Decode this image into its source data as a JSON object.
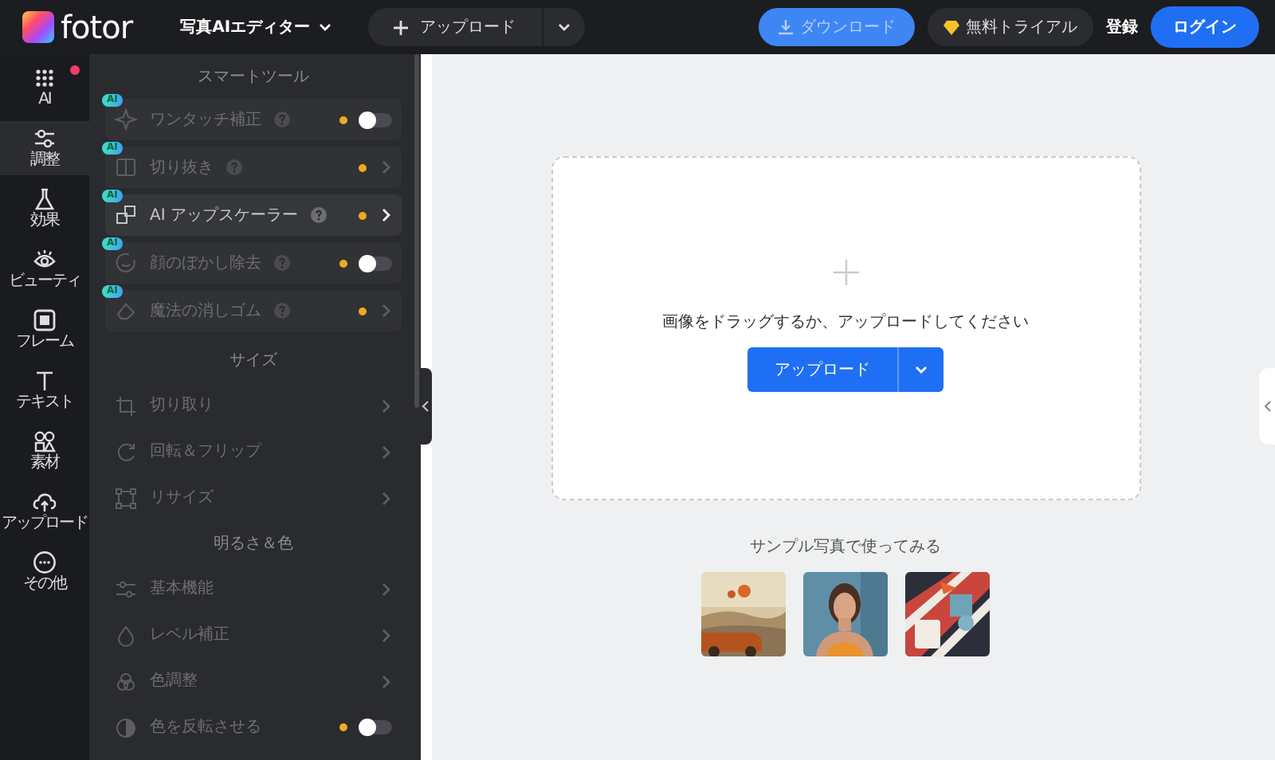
{
  "header": {
    "logo": "fotor",
    "editor_menu": "写真AIエディター",
    "upload_button": "アップロード",
    "download_button": "ダウンロード",
    "download_disabled": true,
    "trial_button": "無料トライアル",
    "signup_link": "登録",
    "login_button": "ログイン"
  },
  "rail": [
    {
      "label": "AI",
      "selected": false,
      "notification": true
    },
    {
      "label": "調整",
      "selected": true,
      "notification": false
    },
    {
      "label": "効果",
      "selected": false,
      "notification": false
    },
    {
      "label": "ビューティ",
      "selected": false,
      "notification": false
    },
    {
      "label": "フレーム",
      "selected": false,
      "notification": false
    },
    {
      "label": "テキスト",
      "selected": false,
      "notification": false
    },
    {
      "label": "素材",
      "selected": false,
      "notification": false
    },
    {
      "label": "アップロード",
      "selected": false,
      "notification": false
    },
    {
      "label": "その他",
      "selected": false,
      "notification": false
    }
  ],
  "panel": [
    {
      "title": "スマートツール",
      "card": true,
      "items": [
        {
          "label": "ワンタッチ補正",
          "badge": "AI",
          "help": true,
          "dot": true,
          "kind": "toggle",
          "on": false,
          "highlighted": false
        },
        {
          "label": "切り抜き",
          "badge": "AI",
          "help": true,
          "dot": true,
          "kind": "arrow",
          "highlighted": false
        },
        {
          "label": "AI アップスケーラー",
          "badge": "AI",
          "help": true,
          "dot": true,
          "kind": "arrow",
          "highlighted": true
        },
        {
          "label": "顔のぼかし除去",
          "badge": "AI",
          "help": true,
          "dot": true,
          "kind": "toggle",
          "on": false,
          "highlighted": false
        },
        {
          "label": "魔法の消しゴム",
          "badge": "AI",
          "help": true,
          "dot": true,
          "kind": "arrow",
          "highlighted": false
        }
      ]
    },
    {
      "title": "サイズ",
      "card": false,
      "items": [
        {
          "label": "切り取り",
          "help": false,
          "dot": false,
          "kind": "arrow",
          "highlighted": false
        },
        {
          "label": "回転＆フリップ",
          "help": false,
          "dot": false,
          "kind": "arrow",
          "highlighted": false
        },
        {
          "label": "リサイズ",
          "help": false,
          "dot": false,
          "kind": "arrow",
          "highlighted": false
        }
      ]
    },
    {
      "title": "明るさ＆色",
      "card": false,
      "items": [
        {
          "label": "基本機能",
          "help": false,
          "dot": false,
          "kind": "arrow",
          "highlighted": false
        },
        {
          "label": "レベル補正",
          "help": false,
          "dot": false,
          "kind": "arrow",
          "highlighted": false
        },
        {
          "label": "色調整",
          "help": false,
          "dot": false,
          "kind": "arrow",
          "highlighted": false
        },
        {
          "label": "色を反転させる",
          "help": false,
          "dot": true,
          "kind": "toggle",
          "on": false,
          "highlighted": false
        }
      ]
    }
  ],
  "dropzone": {
    "text": "画像をドラッグするか、アップロードしてください",
    "upload_button": "アップロード"
  },
  "samples": {
    "title": "サンプル写真で使ってみる"
  }
}
